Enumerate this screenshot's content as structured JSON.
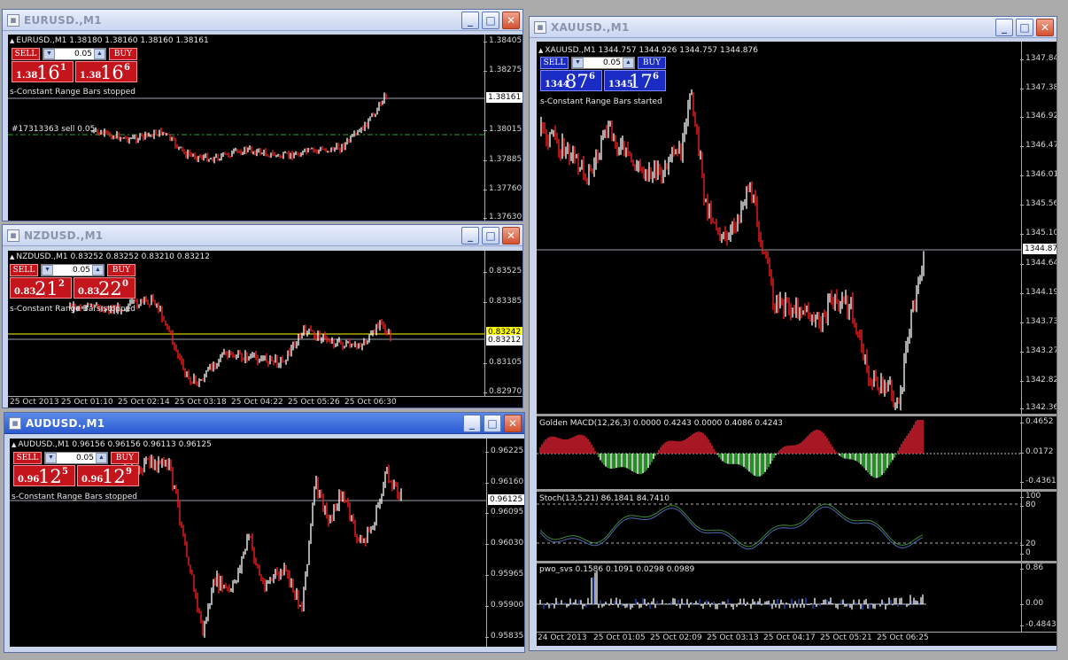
{
  "windows": {
    "eurusd": {
      "title": "EURUSD.,M1",
      "header": "EURUSD.,M1  1.38180 1.38160 1.38160 1.38161",
      "note": "s-Constant Range Bars stopped",
      "order_label": "#17313363 sell 0.05",
      "lot": "0.05",
      "sell_label": "SELL",
      "buy_label": "BUY",
      "sell_small": "1.38",
      "sell_big": "16",
      "sell_pip": "1",
      "buy_small": "1.38",
      "buy_big": "16",
      "buy_pip": "6",
      "price_label": "1.38161",
      "ticks": [
        "1.38405",
        "1.38275",
        "1.38145",
        "1.38015",
        "1.37885",
        "1.37760",
        "1.37630"
      ]
    },
    "nzdusd": {
      "title": "NZDUSD.,M1",
      "header": "NZDUSD.,M1  0.83252 0.83252 0.83210 0.83212",
      "note": "s-Constant Range Bars stopped",
      "lot": "0.05",
      "sell_label": "SELL",
      "buy_label": "BUY",
      "sell_small": "0.83",
      "sell_big": "21",
      "sell_pip": "2",
      "buy_small": "0.83",
      "buy_big": "22",
      "buy_pip": "0",
      "price_label_yellow": "0.83242",
      "price_label": "0.83212",
      "ticks": [
        "0.83525",
        "0.83385",
        "0.83105",
        "0.82970"
      ],
      "time_labels": [
        "25 Oct 2013",
        "25 Oct 01:10",
        "25 Oct 02:14",
        "25 Oct 03:18",
        "25 Oct 04:22",
        "25 Oct 05:26",
        "25 Oct 06:30"
      ]
    },
    "audusd": {
      "title": "AUDUSD.,M1",
      "header": "AUDUSD.,M1  0.96156 0.96156 0.96113 0.96125",
      "note": "s-Constant Range Bars stopped",
      "lot": "0.05",
      "sell_label": "SELL",
      "buy_label": "BUY",
      "sell_small": "0.96",
      "sell_big": "12",
      "sell_pip": "5",
      "buy_small": "0.96",
      "buy_big": "12",
      "buy_pip": "9",
      "price_label": "0.96125",
      "ticks": [
        "0.96225",
        "0.96160",
        "0.96095",
        "0.96030",
        "0.95965",
        "0.95900",
        "0.95835"
      ]
    },
    "xauusd": {
      "title": "XAUUSD.,M1",
      "header": "XAUUSD.,M1  1344.757 1344.926 1344.757 1344.876",
      "note": "s-Constant Range Bars started",
      "lot": "0.05",
      "sell_label": "SELL",
      "buy_label": "BUY",
      "sell_small": "1344",
      "sell_big": "87",
      "sell_pip": "6",
      "buy_small": "1345",
      "buy_big": "17",
      "buy_pip": "6",
      "price_label": "1344.87",
      "ticks": [
        "1347.84",
        "1347.38",
        "1346.92",
        "1346.47",
        "1346.01",
        "1345.56",
        "1345.10",
        "1344.64",
        "1344.19",
        "1343.73",
        "1343.27",
        "1342.82",
        "1342.36"
      ],
      "macd_label": "Golden MACD(12,26,3) 0.0000 0.4243 0.0000 0.4086 0.4243",
      "macd_ticks": [
        "0.4652",
        "0.0172",
        "-0.4361"
      ],
      "stoch_label": "Stoch(13,5,21) 86.1841 84.7410",
      "stoch_ticks": [
        "100",
        "80",
        "20",
        "0"
      ],
      "pwo_label": "pwo_svs 0.1586 0.1091 0.0298 0.0989",
      "pwo_ticks": [
        "0.86",
        "0.00",
        "-0.4843"
      ],
      "time_labels": [
        "24 Oct 2013",
        "25 Oct 01:05",
        "25 Oct 02:09",
        "25 Oct 03:13",
        "25 Oct 04:17",
        "25 Oct 05:21",
        "25 Oct 06:25"
      ]
    }
  },
  "ui": {
    "min_glyph": "_",
    "max_glyph": "□",
    "close_glyph": "✕",
    "down_glyph": "▼",
    "up_glyph": "▲",
    "window_icon": "▦"
  },
  "colors": {
    "bull_bar": "#ffffff",
    "bear_bar": "#ff2020",
    "order_line": "#2ea02e",
    "bid_line": "#9aa0a8",
    "ask_line": "#ffff00",
    "stoch_main": "#3c8a3c",
    "stoch_signal": "#4a6ab0"
  }
}
